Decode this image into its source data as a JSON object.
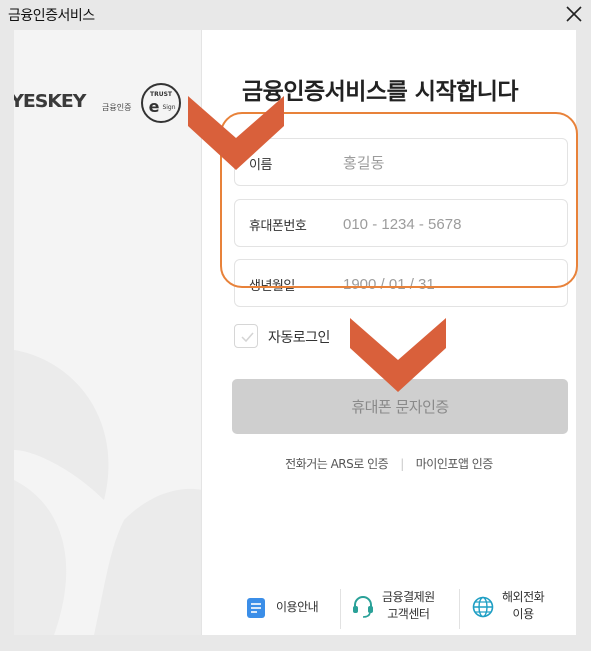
{
  "window": {
    "title": "금융인증서비스"
  },
  "logos": {
    "yeskey": "YESKEY",
    "yeskey_sub": "금융인증",
    "trust_top": "TRUST",
    "trust_bottom": "Sign"
  },
  "form": {
    "heading": "금융인증서비스를 시작합니다",
    "name_label": "이름",
    "name_placeholder": "홍길동",
    "phone_label": "휴대폰번호",
    "phone_placeholder": "010 - 1234 - 5678",
    "birth_label": "생년월일",
    "birth_placeholder": "1900 / 01 / 31",
    "auto_login_label": "자동로그인",
    "auto_login_checked": false,
    "submit_label": "휴대폰 문자인증"
  },
  "alt_links": {
    "ars": "전화거는 ARS로 인증",
    "myinfo": "마이인포앱 인증"
  },
  "footer": {
    "guide": "이용안내",
    "support_line1": "금융결제원",
    "support_line2": "고객센터",
    "overseas_line1": "해외전화",
    "overseas_line2": "이용"
  },
  "colors": {
    "highlight": "#e8823a",
    "arrow": "#d9603b",
    "submit_bg": "#cfcfcf"
  }
}
